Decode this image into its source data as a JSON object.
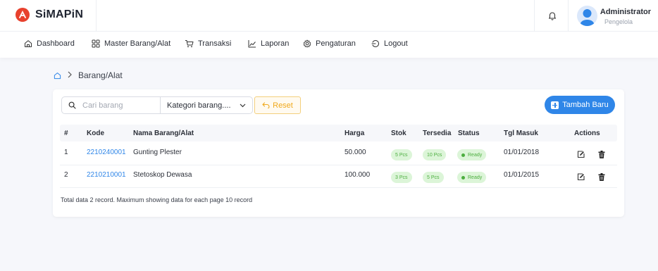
{
  "app": {
    "title": "SiMAPiN"
  },
  "user": {
    "name": "Administrator",
    "role": "Pengelola"
  },
  "nav": {
    "items": [
      {
        "label": "Dashboard",
        "icon": "home-icon"
      },
      {
        "label": "Master Barang/Alat",
        "icon": "grid-icon"
      },
      {
        "label": "Transaksi",
        "icon": "cart-icon"
      },
      {
        "label": "Laporan",
        "icon": "chart-line-icon"
      },
      {
        "label": "Pengaturan",
        "icon": "gear-icon"
      },
      {
        "label": "Logout",
        "icon": "logout-icon"
      }
    ]
  },
  "breadcrumb": {
    "current": "Barang/Alat"
  },
  "filters": {
    "search_placeholder": "Cari barang",
    "category_selected": "Kategori barang....",
    "reset_label": "Reset",
    "add_label": "Tambah Baru"
  },
  "table": {
    "headers": {
      "num": "#",
      "code": "Kode",
      "name": "Nama Barang/Alat",
      "price": "Harga",
      "stock": "Stok",
      "available": "Tersedia",
      "status": "Status",
      "date": "Tgl Masuk",
      "actions": "Actions"
    },
    "rows": [
      {
        "num": "1",
        "code": "2210240001",
        "name": "Gunting Plester",
        "price": "50.000",
        "stock": "5 Pcs",
        "available": "10 Pcs",
        "status": "Ready",
        "date": "01/01/2018"
      },
      {
        "num": "2",
        "code": "2210210001",
        "name": "Stetoskop Dewasa",
        "price": "100.000",
        "stock": "3 Pcs",
        "available": "5 Pcs",
        "status": "Ready",
        "date": "01/01/2015"
      }
    ],
    "footer": "Total data 2 record. Maximum showing data for each page 10 record"
  },
  "colors": {
    "brand": "#e8412d",
    "primary": "#2f86e8",
    "warning": "#f0a91d",
    "success": "#4cae3f"
  }
}
